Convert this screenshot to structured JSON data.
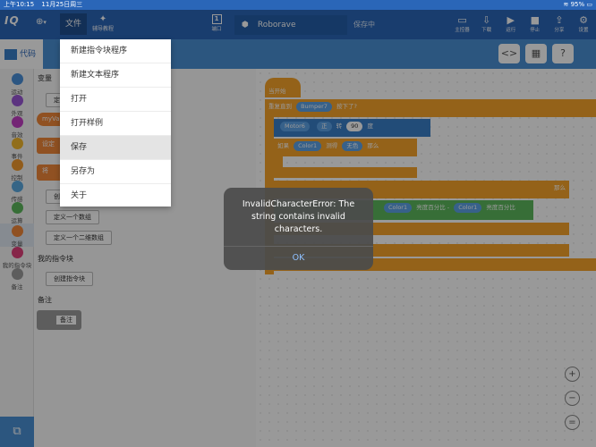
{
  "statusbar": {
    "time": "上午10:15",
    "date": "11月25日周三",
    "battery": "95%"
  },
  "topbar": {
    "logo": "IQ",
    "file_label": "文件",
    "tutorial_label": "辅导教程",
    "port_label": "端口",
    "port_icon": "1",
    "project_name": "Roborave",
    "save_status": "保存中",
    "tools": [
      {
        "icon": "monitor-icon",
        "label": "主控器"
      },
      {
        "icon": "download-icon",
        "label": "下载"
      },
      {
        "icon": "run-icon",
        "label": "运行"
      },
      {
        "icon": "stop-icon",
        "label": "停止"
      },
      {
        "icon": "share-icon",
        "label": "分享"
      },
      {
        "icon": "settings-icon",
        "label": "设置"
      }
    ]
  },
  "tabs": {
    "code_label": "代码"
  },
  "categories": [
    {
      "label": "运动",
      "color": "#4a90d9"
    },
    {
      "label": "外观",
      "color": "#9a57d6"
    },
    {
      "label": "音效",
      "color": "#c23fc3"
    },
    {
      "label": "事件",
      "color": "#f2b82e"
    },
    {
      "label": "控制",
      "color": "#f29a2e"
    },
    {
      "label": "传感",
      "color": "#5ba8e0"
    },
    {
      "label": "运算",
      "color": "#5cb85c"
    },
    {
      "label": "变量",
      "color": "#f0883a"
    },
    {
      "label": "我的指令块",
      "color": "#e0407a"
    },
    {
      "label": "备注",
      "color": "#9b9b9b"
    }
  ],
  "palette": {
    "variables_title": "变量",
    "define_prefix": "定",
    "var_block": "myVar",
    "set_block": "设定",
    "change_block": "将",
    "create_btn": "创",
    "list_btn": "定义一个数组",
    "array2d_btn": "定义一个二维数组",
    "my_blocks_title": "我的指令块",
    "create_block_btn": "创建指令块",
    "notes_title": "备注",
    "note_block": "备注"
  },
  "workspace": {
    "hat": "当开始",
    "repeat_until": "重复直到",
    "bumper": "Bumper7",
    "pressed": "按下了?",
    "motor": "Motor6",
    "direction": "正",
    "turn": "转",
    "degrees_value": "90",
    "degree_unit": "度",
    "if": "如果",
    "color1": "Color1",
    "detect": "测得",
    "no_color": "无色",
    "then": "那么",
    "brightness": "亮度百分比",
    "minus": "-"
  },
  "menu": {
    "items": [
      "新建指令块程序",
      "新建文本程序",
      "打开",
      "打开样例",
      "保存",
      "另存为",
      "关于"
    ]
  },
  "alert": {
    "message": "InvalidCharacterError: The string contains invalid characters.",
    "ok": "OK"
  }
}
